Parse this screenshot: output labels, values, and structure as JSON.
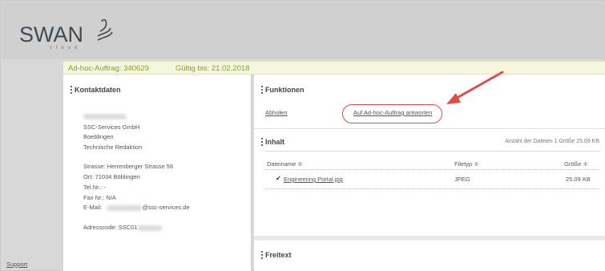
{
  "header": {
    "logo_text": "SWAN",
    "logo_sub": "cloud"
  },
  "infobar": {
    "order": "Ad-hoc-Auftrag: 340629",
    "valid": "Gültig bis: 21.02.2018"
  },
  "contact": {
    "title": "Kontaktdaten",
    "company": "SSC-Services GmbH",
    "city": "Boeblingen",
    "department": "Technische Redaktion",
    "street": "Strasse: Herrenberger Strasse 56",
    "place": "Ort: 71034 Böblingen",
    "tel": "Tel.Nr.: -",
    "fax": "Fax Nr.: N/A",
    "email_label": "E-Mail:",
    "email_domain": "@ssc-services.de",
    "address_code": "Adresscode: SSC01"
  },
  "functions": {
    "title": "Funktionen",
    "pickup": "Abholen",
    "reply": "Auf Ad-hoc-Auftrag antworten"
  },
  "content": {
    "title": "Inhalt",
    "summary": "Anzahl der Dateien 1  Größe 25.09 KB",
    "columns": [
      "Dateiname ≑",
      "Filetyp ≑",
      "Größe ≑"
    ],
    "rows": [
      {
        "name": "Engineering Portal.jpg",
        "type": "JPEG",
        "size": "25.09 KB"
      }
    ]
  },
  "freetext": {
    "title": "Freitext"
  },
  "footer": {
    "support": "Support"
  },
  "colors": {
    "accent_green": "#8aa020",
    "highlight_red": "#e24a4a"
  }
}
